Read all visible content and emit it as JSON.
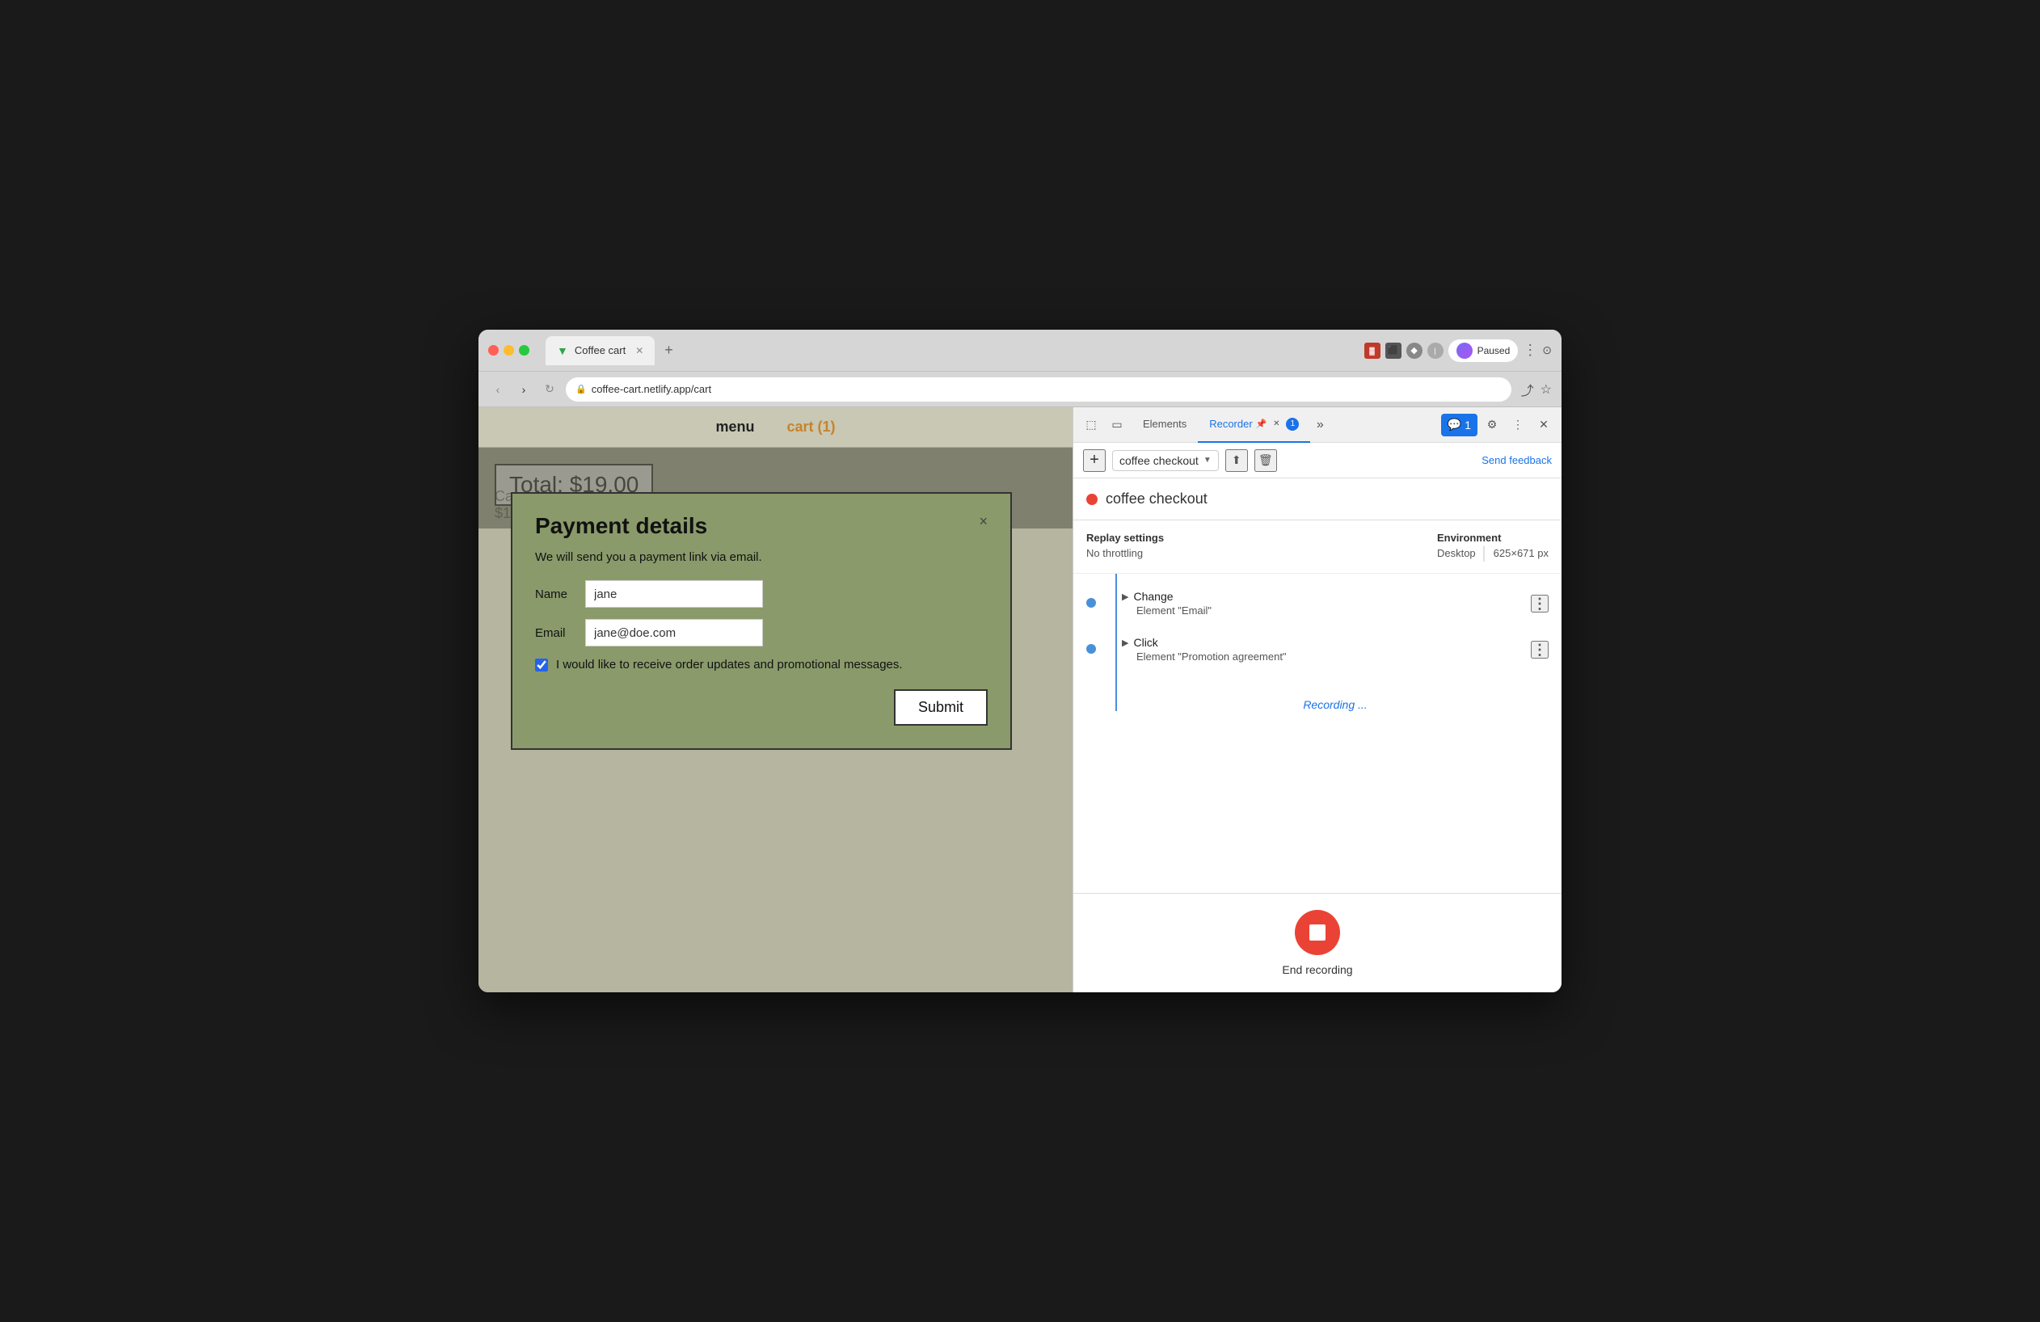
{
  "browser": {
    "tab_title": "Coffee cart",
    "tab_favicon": "▼",
    "url": "coffee-cart.netlify.app/cart",
    "paused_label": "Paused"
  },
  "site": {
    "nav_menu": "menu",
    "nav_cart": "cart (1)",
    "total_label": "Total: $19.00",
    "bg_cart_label": "Ca...",
    "bg_price": "$1..."
  },
  "modal": {
    "title": "Payment details",
    "subtitle": "We will send you a payment link via email.",
    "name_label": "Name",
    "name_value": "jane",
    "email_label": "Email",
    "email_value": "jane@doe.com",
    "checkbox_label": "I would like to receive order updates and promotional messages.",
    "submit_label": "Submit",
    "close_label": "×"
  },
  "devtools": {
    "tab_elements": "Elements",
    "tab_recorder": "Recorder",
    "badge_count": "1",
    "more_tabs_icon": "»",
    "send_feedback": "Send feedback",
    "recording_selector": "coffee checkout",
    "recording_dot_color": "#ea4335",
    "recording_name": "coffee checkout",
    "replay_settings_label": "Replay settings",
    "replay_throttle_label": "No throttling",
    "environment_label": "Environment",
    "environment_value": "Desktop",
    "environment_size": "625×671 px",
    "event1_name": "Change",
    "event1_sub": "Element \"Email\"",
    "event2_name": "Click",
    "event2_sub": "Element \"Promotion agreement\"",
    "recording_status": "Recording ...",
    "end_recording_label": "End recording"
  }
}
